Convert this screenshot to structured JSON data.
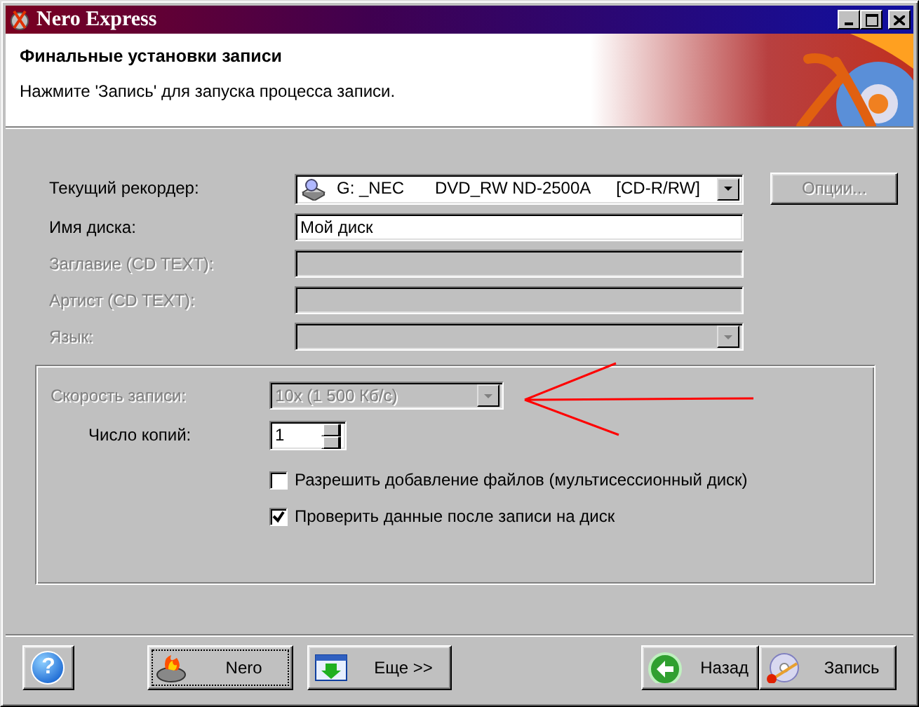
{
  "window": {
    "title": "Nero Express"
  },
  "header": {
    "title": "Финальные установки записи",
    "subtitle": "Нажмите 'Запись' для запуска процесса записи."
  },
  "fields": [
    {
      "kind": "drive",
      "label": "Текущий рекордер:",
      "value_parts": [
        "G: _NEC",
        "DVD_RW ND-2500A",
        "[CD-R/RW]"
      ],
      "disabled": false
    },
    {
      "kind": "text",
      "label": "Имя диска:",
      "value": "Мой диск",
      "disabled": false
    },
    {
      "kind": "text",
      "label": "Заглавие (CD TEXT):",
      "disabled": true
    },
    {
      "kind": "text",
      "label": "Артист (CD TEXT):",
      "disabled": true
    },
    {
      "kind": "dropdown",
      "label": "Язык:",
      "disabled": true
    }
  ],
  "options_button": {
    "label": "Опции...",
    "disabled": true
  },
  "speed": {
    "label": "Скорость записи:",
    "value": "10x (1 500 Кб/с)",
    "disabled": true
  },
  "copies": {
    "label": "Число копий:",
    "value": "1"
  },
  "checkboxes": [
    {
      "label": "Разрешить добавление файлов (мультисессионный диск)",
      "checked": false
    },
    {
      "label": "Проверить данные после записи на диск",
      "checked": true
    }
  ],
  "annotation": {
    "kind": "arrow",
    "color": "#ff0000"
  },
  "buttons": [
    {
      "kind": "help",
      "label": "?",
      "focused": false
    },
    {
      "kind": "nero",
      "label": "Nero",
      "focused": true
    },
    {
      "kind": "more",
      "label": "Еще >>",
      "focused": false
    },
    {
      "kind": "back",
      "label": "Назад",
      "focused": false
    },
    {
      "kind": "burn",
      "label": "Запись",
      "focused": false
    }
  ]
}
